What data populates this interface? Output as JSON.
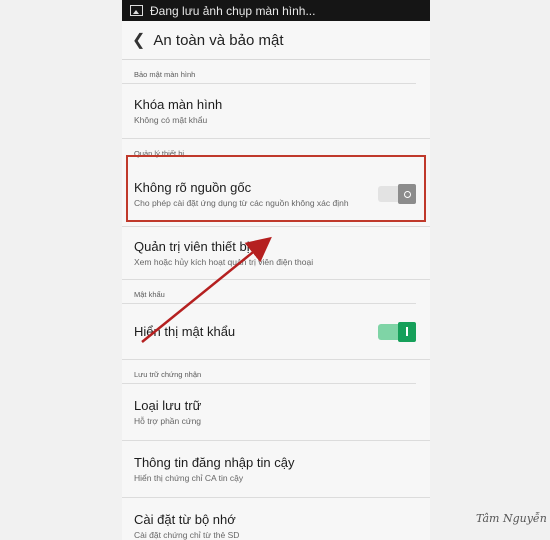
{
  "status_bar": {
    "text": "Đang lưu ảnh chụp màn hình..."
  },
  "app_bar": {
    "title": "An toàn và bảo mật"
  },
  "sections": {
    "screen_security": "Bảo mật màn hình",
    "device_admin": "Quản lý thiết bị",
    "password": "Mật khẩu",
    "credential_storage": "Lưu trữ chứng nhận"
  },
  "items": {
    "lock_screen": {
      "title": "Khóa màn hình",
      "sub": "Không có mật khẩu"
    },
    "unknown_sources": {
      "title": "Không rõ nguồn gốc",
      "sub": "Cho phép cài đặt ứng dụng từ các nguồn không xác định",
      "enabled": false
    },
    "device_admins": {
      "title": "Quản trị viên thiết bị",
      "sub": "Xem hoặc hủy kích hoạt quản trị viên điện thoại"
    },
    "show_password": {
      "title": "Hiển thị mật khẩu",
      "enabled": true
    },
    "storage_type": {
      "title": "Loại lưu trữ",
      "sub": "Hỗ trợ phần cứng"
    },
    "trusted_credentials": {
      "title": "Thông tin đăng nhập tin cậy",
      "sub": "Hiển thị chứng chỉ CA tin cậy"
    },
    "install_from_storage": {
      "title": "Cài đặt từ bộ nhớ",
      "sub": "Cài đặt chứng chỉ từ thẻ SD"
    }
  },
  "colors": {
    "highlight": "#c0392b",
    "toggle_on": "#16a05a"
  },
  "watermark": "Tâm Nguyễn"
}
